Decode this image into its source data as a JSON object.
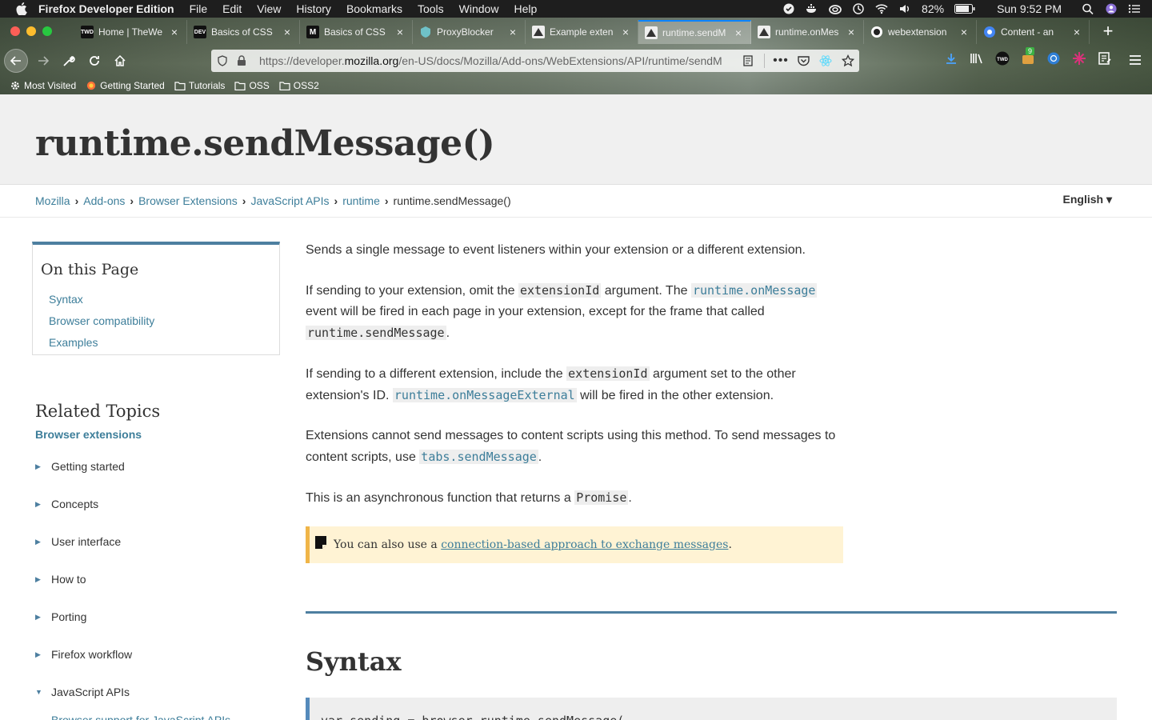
{
  "menubar": {
    "app_name": "Firefox Developer Edition",
    "menus": [
      "File",
      "Edit",
      "View",
      "History",
      "Bookmarks",
      "Tools",
      "Window",
      "Help"
    ],
    "battery": "82%",
    "clock": "Sun 9:52 PM"
  },
  "tabs": [
    {
      "title": "Home | TheWe",
      "favicon": "TWD",
      "active": false
    },
    {
      "title": "Basics of CSS",
      "favicon": "DEV",
      "active": false
    },
    {
      "title": "Basics of CSS",
      "favicon": "M",
      "active": false
    },
    {
      "title": "ProxyBlocker",
      "favicon": "",
      "active": false
    },
    {
      "title": "Example exten",
      "favicon": "",
      "active": false
    },
    {
      "title": "runtime.sendM",
      "favicon": "",
      "active": true
    },
    {
      "title": "runtime.onMes",
      "favicon": "",
      "active": false
    },
    {
      "title": "webextension",
      "favicon": "",
      "active": false
    },
    {
      "title": "Content - an",
      "favicon": "",
      "active": false
    }
  ],
  "urlbar": {
    "url_prefix": "https://developer.",
    "url_domain": "mozilla.org",
    "url_path": "/en-US/docs/Mozilla/Add-ons/WebExtensions/API/runtime/sendM"
  },
  "toolbar": {
    "badge_count": "9"
  },
  "bookmarks": [
    "Most Visited",
    "Getting Started",
    "Tutorials",
    "OSS",
    "OSS2"
  ],
  "page": {
    "title": "runtime.sendMessage()",
    "language": "English ▾",
    "breadcrumbs": [
      "Mozilla",
      "Add-ons",
      "Browser Extensions",
      "JavaScript APIs",
      "runtime"
    ],
    "breadcrumb_current": "runtime.sendMessage()"
  },
  "toc": {
    "heading": "On this Page",
    "links": [
      "Syntax",
      "Browser compatibility",
      "Examples"
    ]
  },
  "related": {
    "heading": "Related Topics",
    "subheading": "Browser extensions",
    "items": [
      {
        "label": "Getting started",
        "expanded": false
      },
      {
        "label": "Concepts",
        "expanded": false
      },
      {
        "label": "User interface",
        "expanded": false
      },
      {
        "label": "How to",
        "expanded": false
      },
      {
        "label": "Porting",
        "expanded": false
      },
      {
        "label": "Firefox workflow",
        "expanded": false
      },
      {
        "label": "JavaScript APIs",
        "expanded": true
      }
    ],
    "sub_item": "Browser support for JavaScript APIs"
  },
  "content": {
    "p1": "Sends a single message to event listeners within your extension or a different extension.",
    "p2_a": "If sending to your extension, omit the ",
    "p2_code1": "extensionId",
    "p2_b": " argument. The ",
    "p2_code2": "runtime.onMessage",
    "p2_c": " event will be fired in each page in your extension, except for the frame that called ",
    "p2_code3": "runtime.sendMessage",
    "p2_d": ".",
    "p3_a": "If sending to a different extension, include the ",
    "p3_code1": "extensionId",
    "p3_b": " argument set to the other extension's ID. ",
    "p3_code2": "runtime.onMessageExternal",
    "p3_c": " will be fired in the other extension.",
    "p4_a": "Extensions cannot send messages to content scripts using this method. To send messages to content scripts, use ",
    "p4_code": "tabs.sendMessage",
    "p4_b": ".",
    "p5_a": "This is an asynchronous function that returns a ",
    "p5_code": "Promise",
    "p5_b": "."
  },
  "note": {
    "text": "You can also use a ",
    "link": "connection-based approach to exchange messages",
    "end": "."
  },
  "syntax": {
    "title": "Syntax",
    "code": "var sending = browser.runtime.sendMessage("
  }
}
